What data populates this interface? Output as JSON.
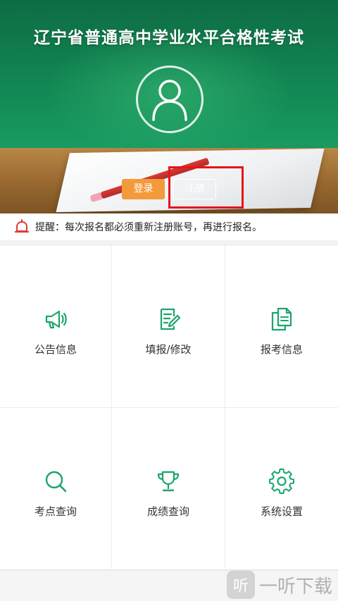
{
  "header": {
    "title": "辽宁省普通高中学业水平合格性考试",
    "login_label": "登录",
    "register_label": "注册"
  },
  "notice": {
    "text": "提醒：每次报名都必须重新注册账号，再进行报名。",
    "icon": "alarm-bell-icon"
  },
  "menu": {
    "items": [
      {
        "label": "公告信息",
        "icon": "megaphone-icon"
      },
      {
        "label": "填报/修改",
        "icon": "edit-form-icon"
      },
      {
        "label": "报考信息",
        "icon": "documents-icon"
      },
      {
        "label": "考点查询",
        "icon": "search-icon"
      },
      {
        "label": "成绩查询",
        "icon": "trophy-icon"
      },
      {
        "label": "系统设置",
        "icon": "gear-icon"
      }
    ]
  },
  "watermark": {
    "badge": "听",
    "text": "一听下载"
  },
  "colors": {
    "accent_green": "#1aa56a",
    "login_orange": "#f39a3b",
    "highlight_red": "#e4141b",
    "notice_red": "#e03a3a"
  }
}
